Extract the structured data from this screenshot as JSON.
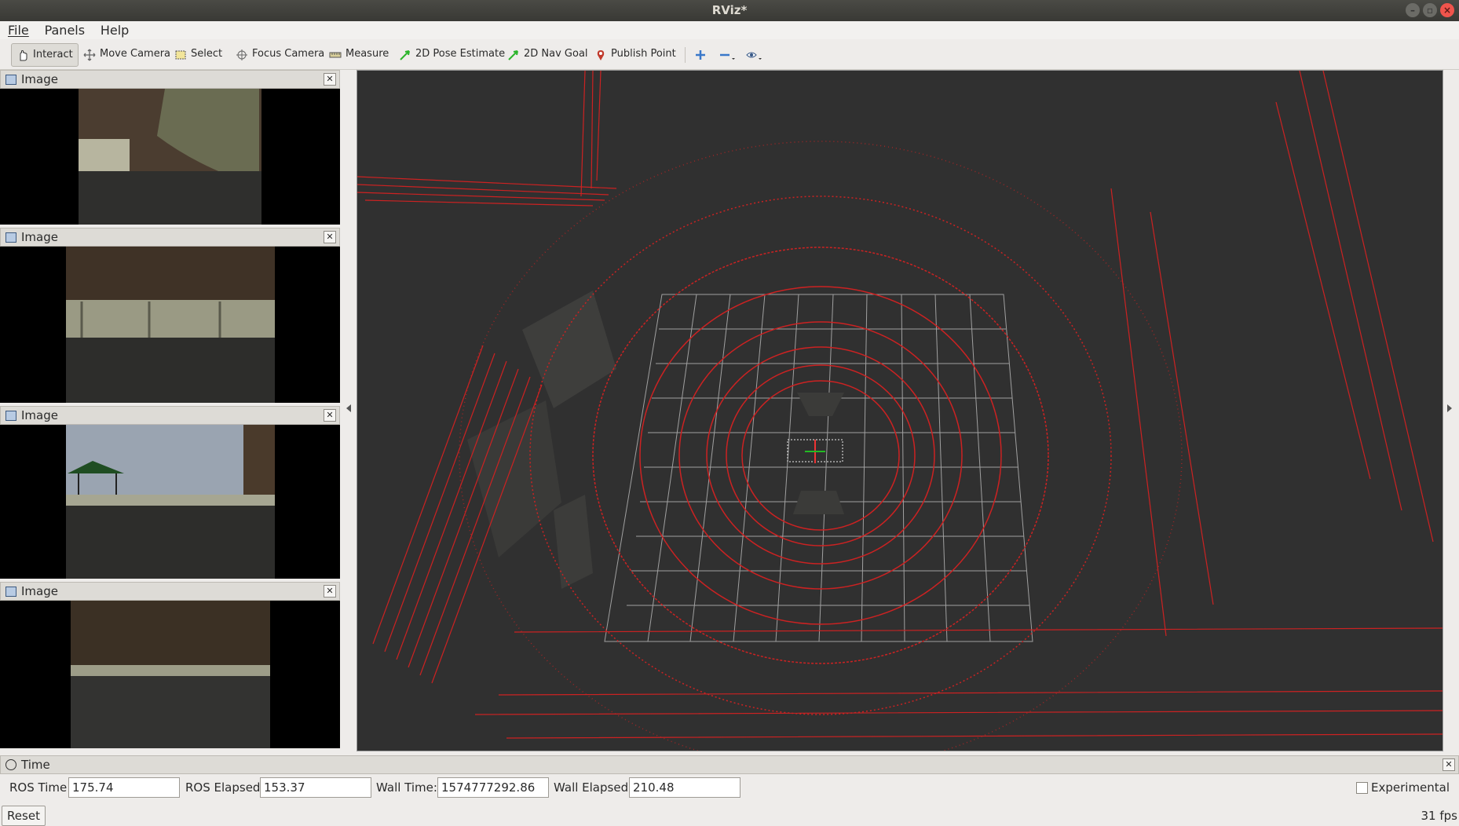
{
  "window": {
    "title": "RViz*"
  },
  "menu": {
    "file": "File",
    "panels": "Panels",
    "help": "Help"
  },
  "toolbar": {
    "interact": "Interact",
    "move_camera": "Move Camera",
    "select": "Select",
    "focus_camera": "Focus Camera",
    "measure": "Measure",
    "pose_estimate": "2D Pose Estimate",
    "nav_goal": "2D Nav Goal",
    "publish_point": "Publish Point"
  },
  "image_panels": [
    {
      "title": "Image"
    },
    {
      "title": "Image"
    },
    {
      "title": "Image"
    },
    {
      "title": "Image"
    }
  ],
  "time_panel": {
    "title": "Time",
    "ros_time_label": "ROS Time:",
    "ros_time": "175.74",
    "ros_elapsed_label": "ROS Elapsed:",
    "ros_elapsed": "153.37",
    "wall_time_label": "Wall Time:",
    "wall_time": "1574777292.86",
    "wall_elapsed_label": "Wall Elapsed:",
    "wall_elapsed": "210.48",
    "experimental_label": "Experimental",
    "reset_label": "Reset",
    "fps": "31 fps"
  },
  "colors": {
    "laser": "#cc2222",
    "grid": "#a0a0a0",
    "viewport_bg": "#303030"
  }
}
